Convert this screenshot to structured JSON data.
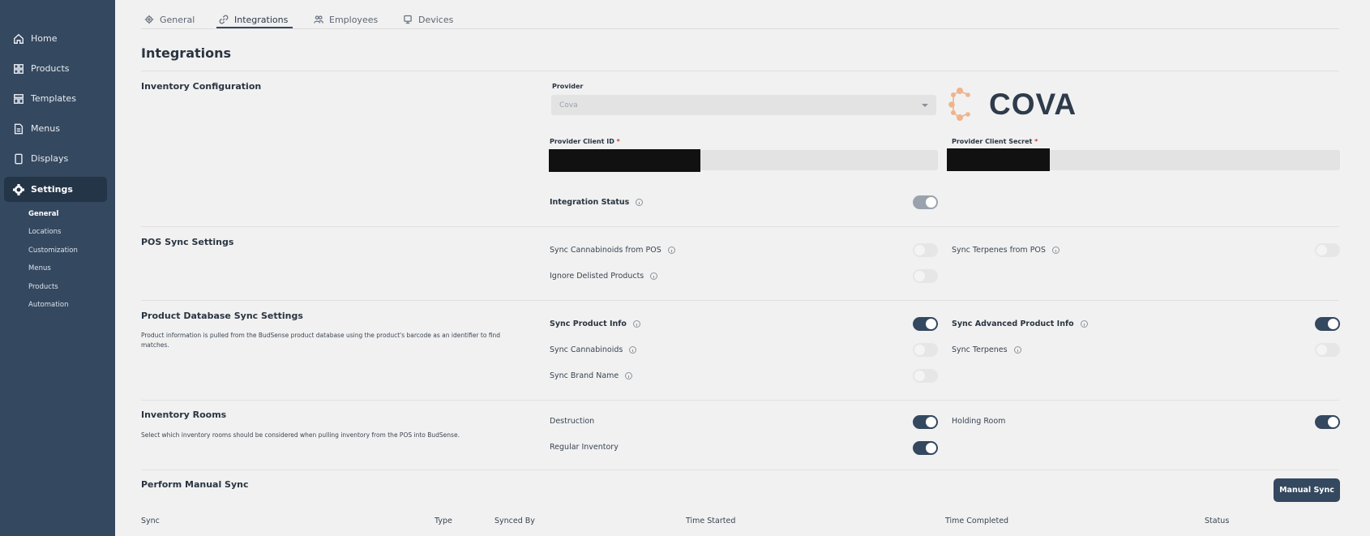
{
  "sidebar": {
    "items": [
      {
        "label": "Home",
        "icon": "home-icon"
      },
      {
        "label": "Products",
        "icon": "grid-icon"
      },
      {
        "label": "Templates",
        "icon": "template-icon"
      },
      {
        "label": "Menus",
        "icon": "document-icon"
      },
      {
        "label": "Displays",
        "icon": "tablet-icon"
      },
      {
        "label": "Settings",
        "icon": "gear-icon"
      }
    ],
    "sub_items": [
      "General",
      "Locations",
      "Customization",
      "Menus",
      "Products",
      "Automation"
    ]
  },
  "tabs": [
    {
      "label": "General",
      "icon": "gear-icon"
    },
    {
      "label": "Integrations",
      "icon": "link-icon"
    },
    {
      "label": "Employees",
      "icon": "people-icon"
    },
    {
      "label": "Devices",
      "icon": "monitor-icon"
    }
  ],
  "page_title": "Integrations",
  "inventory_config": {
    "title": "Inventory Configuration",
    "provider_label": "Provider",
    "provider_value": "Cova",
    "logo_text": "COVA",
    "client_id_label": "Provider Client ID",
    "client_secret_label": "Provider Client Secret",
    "required_mark": "*",
    "integration_status_label": "Integration Status",
    "integration_status": true
  },
  "pos_sync": {
    "title": "POS Sync Settings",
    "items": [
      {
        "label": "Sync Cannabinoids from POS",
        "on": false
      },
      {
        "label": "Sync Terpenes from POS",
        "on": false
      },
      {
        "label": "Ignore Delisted Products",
        "on": false
      }
    ]
  },
  "product_db_sync": {
    "title": "Product Database Sync Settings",
    "description": "Product information is pulled from the BudSense product database using the product's barcode as an identifier to find matches.",
    "items": [
      {
        "label": "Sync Product Info",
        "on": true
      },
      {
        "label": "Sync Advanced Product Info",
        "on": true
      },
      {
        "label": "Sync Cannabinoids",
        "on": false
      },
      {
        "label": "Sync Terpenes",
        "on": false
      },
      {
        "label": "Sync Brand Name",
        "on": false
      }
    ]
  },
  "inventory_rooms": {
    "title": "Inventory Rooms",
    "description": "Select which inventory rooms should be considered when pulling inventory from the POS into BudSense.",
    "items": [
      {
        "label": "Destruction",
        "on": true
      },
      {
        "label": "Holding Room",
        "on": true
      },
      {
        "label": "Regular Inventory",
        "on": true
      }
    ]
  },
  "manual_sync": {
    "title": "Perform Manual Sync",
    "button_label": "Manual Sync",
    "columns": [
      "Sync",
      "Type",
      "Synced By",
      "Time Started",
      "Time Completed",
      "Status"
    ]
  }
}
